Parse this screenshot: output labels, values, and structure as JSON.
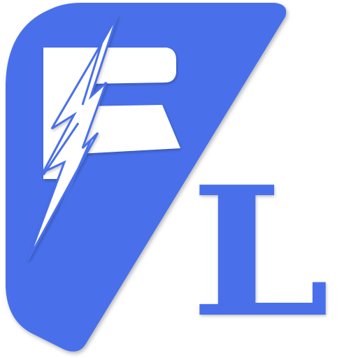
{
  "logo": {
    "letter": "L",
    "icon": "lightning-bolt-icon",
    "colors": {
      "primary": "#4a6fea",
      "white": "#ffffff",
      "shadow": "#2a3f8a"
    }
  }
}
